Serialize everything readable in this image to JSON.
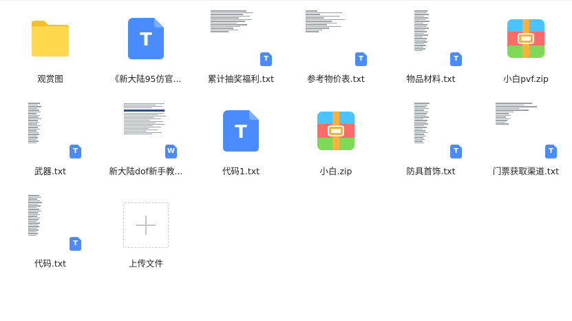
{
  "files": [
    {
      "name": "观赏图",
      "icon": "folder-icon",
      "type": "folder"
    },
    {
      "name": "《新大陆95仿官...",
      "icon": "text-file-icon",
      "type": "txt"
    },
    {
      "name": "累计抽奖福利.txt",
      "icon": "text-preview",
      "type": "txt"
    },
    {
      "name": "参考物价表.txt",
      "icon": "text-preview",
      "type": "txt"
    },
    {
      "name": "物品材料.txt",
      "icon": "text-preview",
      "type": "txt"
    },
    {
      "name": "小白pvf.zip",
      "icon": "zip-icon",
      "type": "zip"
    },
    {
      "name": "武器.txt",
      "icon": "text-preview",
      "type": "txt"
    },
    {
      "name": "新大陆dof新手教...",
      "icon": "doc-preview",
      "type": "doc"
    },
    {
      "name": "代码1.txt",
      "icon": "text-file-icon",
      "type": "txt"
    },
    {
      "name": "小白.zip",
      "icon": "zip-icon",
      "type": "zip"
    },
    {
      "name": "防具首饰.txt",
      "icon": "text-preview",
      "type": "txt"
    },
    {
      "name": "门票获取渠道.txt",
      "icon": "text-preview",
      "type": "txt"
    },
    {
      "name": "代码.txt",
      "icon": "text-preview",
      "type": "txt"
    }
  ],
  "upload": {
    "label": "上传文件",
    "icon": "plus-icon"
  },
  "badges": {
    "txt": "T",
    "doc": "W"
  },
  "colors": {
    "folder": "#ffd13d",
    "text_icon": "#4a8bff",
    "zip_top": "#4cc3ff",
    "zip_mid": "#ff6b6b",
    "zip_bottom": "#7ed957",
    "zip_zipper": "#ffb03b"
  }
}
